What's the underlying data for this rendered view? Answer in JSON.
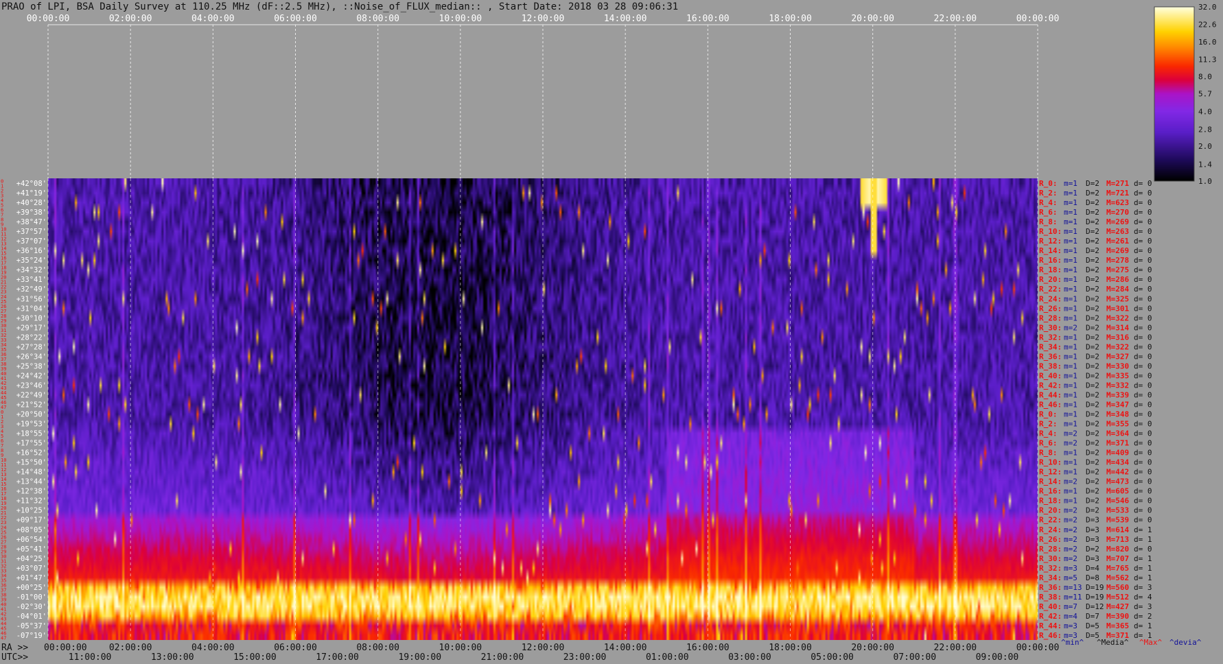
{
  "chart_data": {
    "type": "heatmap",
    "title": "PRAO of LPI, BSA Daily Survey at 110.25 MHz (dF::2.5 MHz), ::Noise_of_FLUX_median:: , Start Date: 2018 03 28 09:06:31",
    "top_axis": {
      "ticks": [
        "00:00:00",
        "02:00:00",
        "04:00:00",
        "06:00:00",
        "08:00:00",
        "10:00:00",
        "12:00:00",
        "14:00:00",
        "16:00:00",
        "18:00:00",
        "20:00:00",
        "22:00:00",
        "00:00:00"
      ],
      "unit": "RA (h)",
      "range": [
        0,
        24
      ]
    },
    "bottom_axis": {
      "label_ra": "RA >>",
      "label_utc": "UTC>>",
      "ra_ticks": [
        "00:00:00",
        "02:00:00",
        "04:00:00",
        "06:00:00",
        "08:00:00",
        "10:00:00",
        "12:00:00",
        "14:00:00",
        "16:00:00",
        "18:00:00",
        "20:00:00",
        "22:00:00",
        "00:00:00"
      ],
      "utc_ticks": [
        "11:00:00",
        "13:00:00",
        "15:00:00",
        "17:00:00",
        "19:00:00",
        "21:00:00",
        "23:00:00",
        "01:00:00",
        "03:00:00",
        "05:00:00",
        "07:00:00",
        "09:00:00"
      ]
    },
    "declinations": [
      "+42°08'",
      "+41°19'",
      "+40°28'",
      "+39°38'",
      "+38°47'",
      "+37°57'",
      "+37°07'",
      "+36°16'",
      "+35°24'",
      "+34°32'",
      "+33°41'",
      "+32°49'",
      "+31°56'",
      "+31°04'",
      "+30°10'",
      "+29°17'",
      "+28°22'",
      "+27°28'",
      "+26°34'",
      "+25°38'",
      "+24°42'",
      "+23°46'",
      "+22°49'",
      "+21°52'",
      "+20°50'",
      "+19°53'",
      "+18°55'",
      "+17°55'",
      "+16°52'",
      "+15°50'",
      "+14°48'",
      "+13°44'",
      "+12°38'",
      "+11°32'",
      "+10°25'",
      "+09°17'",
      "+08°05'",
      "+06°54'",
      "+05°41'",
      "+04°25'",
      "+03°07'",
      "+01°47'",
      "+00°25'",
      "-01°00'",
      "-02°30'",
      "-04°01'",
      "-05°37'",
      "-07°19'"
    ],
    "row_indices": [
      "0",
      "1",
      "2",
      "3",
      "4",
      "5",
      "6",
      "7",
      "8",
      "9",
      "10",
      "11",
      "12",
      "13",
      "14",
      "15",
      "16",
      "17",
      "18",
      "19",
      "20",
      "21",
      "22",
      "23",
      "24",
      "25",
      "26",
      "27",
      "28",
      "29",
      "30",
      "31",
      "32",
      "33",
      "34",
      "35",
      "36",
      "37",
      "38",
      "39",
      "40",
      "41",
      "42",
      "43",
      "44",
      "45",
      "46",
      "47",
      "0",
      "1",
      "2",
      "3",
      "4",
      "5",
      "6",
      "7",
      "8",
      "9",
      "10",
      "11",
      "12",
      "13",
      "14",
      "15",
      "16",
      "17",
      "18",
      "19",
      "20",
      "21",
      "22",
      "23",
      "24",
      "25",
      "26",
      "27",
      "28",
      "29",
      "30",
      "31",
      "32",
      "33",
      "34",
      "35",
      "36",
      "37",
      "38",
      "39",
      "40",
      "41",
      "42",
      "43",
      "44",
      "45",
      "46",
      "47"
    ],
    "colorbar": {
      "ticks": [
        "32.0",
        "22.6",
        "16.0",
        "11.3",
        "8.0",
        "5.7",
        "4.0",
        "2.8",
        "2.0",
        "1.4",
        "1.0"
      ],
      "range": [
        1.0,
        32.0
      ],
      "scale": "log"
    },
    "stats_rows": [
      {
        "r": "R_0:",
        "m": "m=1",
        "D": "D=2",
        "M": "M=271",
        "d": "d= 0"
      },
      {
        "r": "R_2:",
        "m": "m=1",
        "D": "D=2",
        "M": "M=721",
        "d": "d= 0"
      },
      {
        "r": "R_4:",
        "m": "m=1",
        "D": "D=2",
        "M": "M=623",
        "d": "d= 0"
      },
      {
        "r": "R_6:",
        "m": "m=1",
        "D": "D=2",
        "M": "M=270",
        "d": "d= 0"
      },
      {
        "r": "R_8:",
        "m": "m=1",
        "D": "D=2",
        "M": "M=269",
        "d": "d= 0"
      },
      {
        "r": "R_10:",
        "m": "m=1",
        "D": "D=2",
        "M": "M=263",
        "d": "d= 0"
      },
      {
        "r": "R_12:",
        "m": "m=1",
        "D": "D=2",
        "M": "M=261",
        "d": "d= 0"
      },
      {
        "r": "R_14:",
        "m": "m=1",
        "D": "D=2",
        "M": "M=269",
        "d": "d= 0"
      },
      {
        "r": "R_16:",
        "m": "m=1",
        "D": "D=2",
        "M": "M=278",
        "d": "d= 0"
      },
      {
        "r": "R_18:",
        "m": "m=1",
        "D": "D=2",
        "M": "M=275",
        "d": "d= 0"
      },
      {
        "r": "R_20:",
        "m": "m=1",
        "D": "D=2",
        "M": "M=286",
        "d": "d= 0"
      },
      {
        "r": "R_22:",
        "m": "m=1",
        "D": "D=2",
        "M": "M=284",
        "d": "d= 0"
      },
      {
        "r": "R_24:",
        "m": "m=1",
        "D": "D=2",
        "M": "M=325",
        "d": "d= 0"
      },
      {
        "r": "R_26:",
        "m": "m=1",
        "D": "D=2",
        "M": "M=301",
        "d": "d= 0"
      },
      {
        "r": "R_28:",
        "m": "m=1",
        "D": "D=2",
        "M": "M=322",
        "d": "d= 0"
      },
      {
        "r": "R_30:",
        "m": "m=2",
        "D": "D=2",
        "M": "M=314",
        "d": "d= 0"
      },
      {
        "r": "R_32:",
        "m": "m=1",
        "D": "D=2",
        "M": "M=316",
        "d": "d= 0"
      },
      {
        "r": "R_34:",
        "m": "m=1",
        "D": "D=2",
        "M": "M=322",
        "d": "d= 0"
      },
      {
        "r": "R_36:",
        "m": "m=1",
        "D": "D=2",
        "M": "M=327",
        "d": "d= 0"
      },
      {
        "r": "R_38:",
        "m": "m=1",
        "D": "D=2",
        "M": "M=330",
        "d": "d= 0"
      },
      {
        "r": "R_40:",
        "m": "m=1",
        "D": "D=2",
        "M": "M=335",
        "d": "d= 0"
      },
      {
        "r": "R_42:",
        "m": "m=1",
        "D": "D=2",
        "M": "M=332",
        "d": "d= 0"
      },
      {
        "r": "R_44:",
        "m": "m=1",
        "D": "D=2",
        "M": "M=339",
        "d": "d= 0"
      },
      {
        "r": "R_46:",
        "m": "m=1",
        "D": "D=2",
        "M": "M=347",
        "d": "d= 0"
      },
      {
        "r": "R_0:",
        "m": "m=1",
        "D": "D=2",
        "M": "M=348",
        "d": "d= 0"
      },
      {
        "r": "R_2:",
        "m": "m=1",
        "D": "D=2",
        "M": "M=355",
        "d": "d= 0"
      },
      {
        "r": "R_4:",
        "m": "m=2",
        "D": "D=2",
        "M": "M=364",
        "d": "d= 0"
      },
      {
        "r": "R_6:",
        "m": "m=2",
        "D": "D=2",
        "M": "M=371",
        "d": "d= 0"
      },
      {
        "r": "R_8:",
        "m": "m=1",
        "D": "D=2",
        "M": "M=409",
        "d": "d= 0"
      },
      {
        "r": "R_10:",
        "m": "m=1",
        "D": "D=2",
        "M": "M=434",
        "d": "d= 0"
      },
      {
        "r": "R_12:",
        "m": "m=1",
        "D": "D=2",
        "M": "M=442",
        "d": "d= 0"
      },
      {
        "r": "R_14:",
        "m": "m=2",
        "D": "D=2",
        "M": "M=473",
        "d": "d= 0"
      },
      {
        "r": "R_16:",
        "m": "m=1",
        "D": "D=2",
        "M": "M=605",
        "d": "d= 0"
      },
      {
        "r": "R_18:",
        "m": "m=1",
        "D": "D=2",
        "M": "M=546",
        "d": "d= 0"
      },
      {
        "r": "R_20:",
        "m": "m=2",
        "D": "D=2",
        "M": "M=533",
        "d": "d= 0"
      },
      {
        "r": "R_22:",
        "m": "m=2",
        "D": "D=3",
        "M": "M=539",
        "d": "d= 0"
      },
      {
        "r": "R_24:",
        "m": "m=2",
        "D": "D=3",
        "M": "M=614",
        "d": "d= 1"
      },
      {
        "r": "R_26:",
        "m": "m=2",
        "D": "D=3",
        "M": "M=713",
        "d": "d= 1"
      },
      {
        "r": "R_28:",
        "m": "m=2",
        "D": "D=2",
        "M": "M=820",
        "d": "d= 0"
      },
      {
        "r": "R_30:",
        "m": "m=2",
        "D": "D=3",
        "M": "M=707",
        "d": "d= 1"
      },
      {
        "r": "R_32:",
        "m": "m=3",
        "D": "D=4",
        "M": "M=765",
        "d": "d= 1"
      },
      {
        "r": "R_34:",
        "m": "m=5",
        "D": "D=8",
        "M": "M=562",
        "d": "d= 1"
      },
      {
        "r": "R_36:",
        "m": "m=13",
        "D": "D=19",
        "M": "M=560",
        "d": "d= 3"
      },
      {
        "r": "R_38:",
        "m": "m=11",
        "D": "D=19",
        "M": "M=512",
        "d": "d= 4"
      },
      {
        "r": "R_40:",
        "m": "m=7",
        "D": "D=12",
        "M": "M=427",
        "d": "d= 3"
      },
      {
        "r": "R_42:",
        "m": "m=4",
        "D": "D=7",
        "M": "M=390",
        "d": "d= 2"
      },
      {
        "r": "R_44:",
        "m": "m=3",
        "D": "D=5",
        "M": "M=365",
        "d": "d= 1"
      },
      {
        "r": "R_46:",
        "m": "m=3",
        "D": "D=5",
        "M": "M=371",
        "d": "d= 1"
      }
    ],
    "stats_footer": [
      "^min^",
      "^Media^",
      "^Max^",
      "^devia^"
    ],
    "bright_band": {
      "rows": [
        42,
        47
      ],
      "level": "saturated"
    },
    "transient_feature": {
      "ra_h": 20.0,
      "dec": "+41°19'",
      "description_level": 32.0
    }
  },
  "colors": {
    "background": "#9c9c9c",
    "title_text": "#111111",
    "red_text": "#ee1111",
    "blue_text": "#111199",
    "tick_text": "#ffffff"
  }
}
